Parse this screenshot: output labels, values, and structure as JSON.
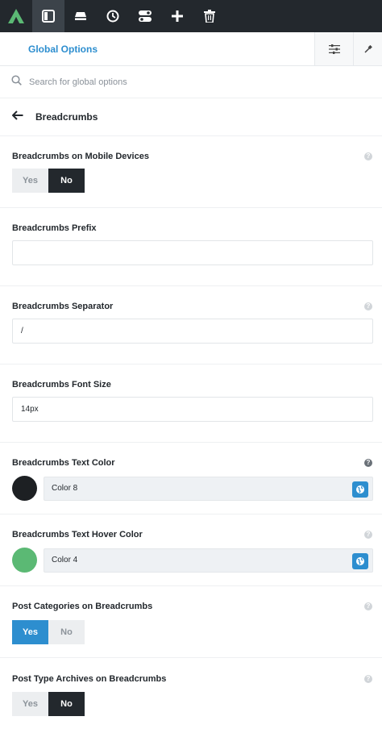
{
  "topbar": {
    "items": [
      {
        "name": "logo",
        "icon": "brand-logo-icon"
      },
      {
        "name": "panel",
        "icon": "sidebar-panel-icon",
        "active": true
      },
      {
        "name": "inbox",
        "icon": "tray-icon"
      },
      {
        "name": "history",
        "icon": "clock-icon"
      },
      {
        "name": "toggles",
        "icon": "toggle-switch-icon"
      },
      {
        "name": "add",
        "icon": "plus-icon"
      },
      {
        "name": "trash",
        "icon": "trash-icon"
      }
    ],
    "colors": {
      "bar": "#23282d",
      "logo": "#5bb974"
    }
  },
  "header": {
    "title": "Global Options",
    "actions": [
      {
        "icon": "sliders-icon"
      },
      {
        "icon": "eyedropper-icon"
      }
    ]
  },
  "search": {
    "placeholder": "Search for global options",
    "icon": "search-icon"
  },
  "page": {
    "title": "Breadcrumbs",
    "back_icon": "arrow-left-icon"
  },
  "fields": {
    "mobile": {
      "label": "Breadcrumbs on Mobile Devices",
      "options": [
        "Yes",
        "No"
      ],
      "selected": "No"
    },
    "prefix": {
      "label": "Breadcrumbs Prefix",
      "value": ""
    },
    "separator": {
      "label": "Breadcrumbs Separator",
      "value": "/"
    },
    "font_size": {
      "label": "Breadcrumbs Font Size",
      "value": "14px"
    },
    "text_color": {
      "label": "Breadcrumbs Text Color",
      "value": "Color 8",
      "swatch": "#1d2023"
    },
    "hover_color": {
      "label": "Breadcrumbs Text Hover Color",
      "value": "Color 4",
      "swatch": "#5bb974"
    },
    "post_categories": {
      "label": "Post Categories on Breadcrumbs",
      "options": [
        "Yes",
        "No"
      ],
      "selected": "Yes"
    },
    "post_type_archives": {
      "label": "Post Type Archives on Breadcrumbs",
      "options": [
        "Yes",
        "No"
      ],
      "selected": "No"
    }
  },
  "accent": "#2d8ecf"
}
